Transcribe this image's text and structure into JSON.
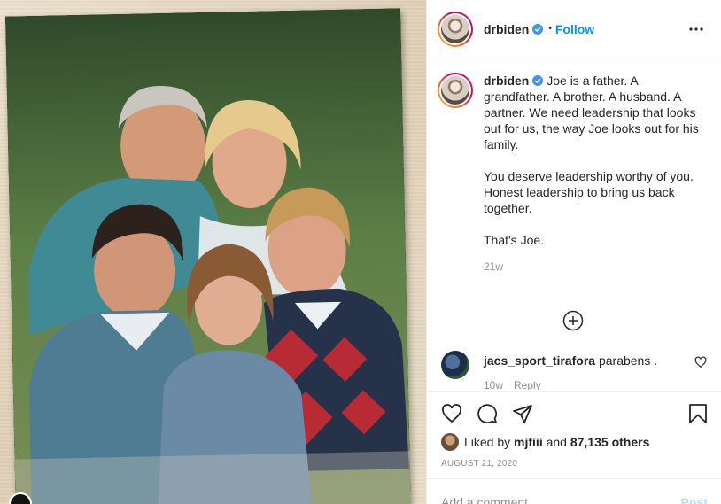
{
  "post": {
    "username": "drbiden",
    "follow_label": "Follow",
    "separator": "•",
    "more_icon": "more-horizontal-icon",
    "photo_alt": "Family portrait photograph"
  },
  "caption": {
    "username": "drbiden",
    "paragraphs": [
      "Joe is a father. A grandfather. A brother. A husband. A partner. We need leadership that looks out for us, the way Joe looks out for his family.",
      "You deserve leadership worthy of you. Honest leadership to bring us back together.",
      "That's Joe."
    ],
    "time": "21w"
  },
  "load_more_icon": "plus-circle-icon",
  "comments": [
    {
      "username": "jacs_sport_tirafora",
      "text": "parabens .",
      "time": "10w",
      "reply_label": "Reply"
    }
  ],
  "actions": {
    "icons": [
      "heart-icon",
      "comment-icon",
      "share-icon",
      "bookmark-icon"
    ]
  },
  "likes": {
    "prefix": "Liked by",
    "user": "mjfiii",
    "joiner": "and",
    "count_text": "87,135 others"
  },
  "date": "AUGUST 21, 2020",
  "comment_box": {
    "placeholder": "Add a comment...",
    "post_label": "Post"
  },
  "colors": {
    "accent": "#0095f6",
    "post_disabled": "#b2dffc",
    "muted": "#8e8e8e",
    "text": "#262626"
  }
}
